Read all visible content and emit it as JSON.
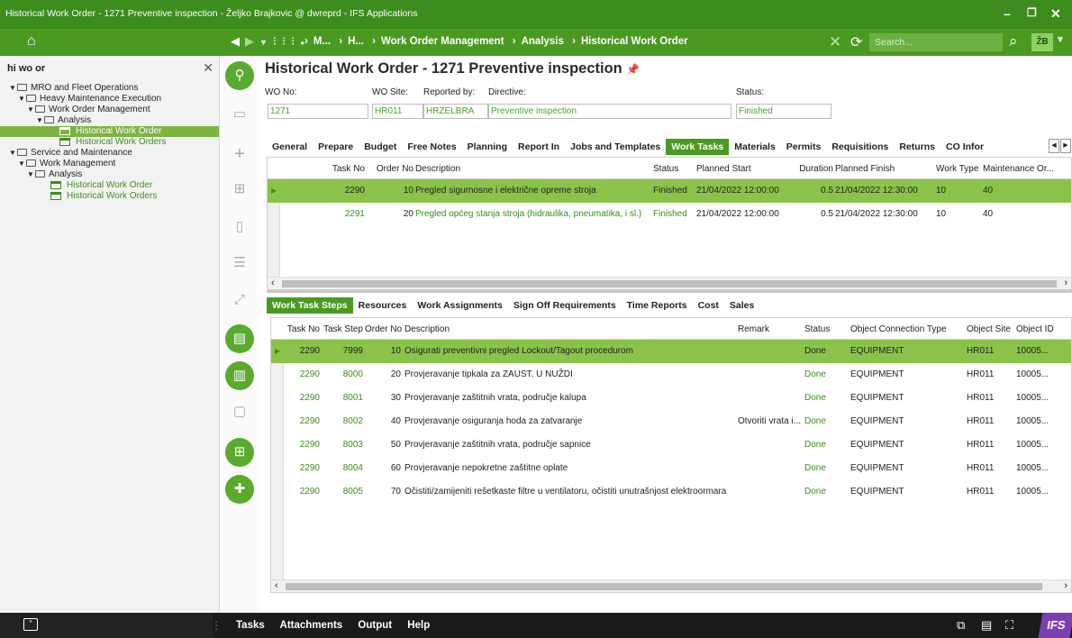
{
  "window": {
    "title": "Historical Work Order - 1271 Preventive inspection - Željko Brajkovic @ dwreprd - IFS Applications"
  },
  "nav": {
    "breadcrumbs": [
      "M...",
      "H...",
      "Work Order Management",
      "Analysis",
      "Historical Work Order"
    ],
    "search_placeholder": "Search...",
    "user_initials": "ŽB"
  },
  "navigator": {
    "search_text": "hi wo or",
    "tree": [
      {
        "label": "MRO and Fleet Operations",
        "level": 0,
        "type": "folder"
      },
      {
        "label": "Heavy Maintenance Execution",
        "level": 1,
        "type": "folder"
      },
      {
        "label": "Work Order Management",
        "level": 2,
        "type": "folder"
      },
      {
        "label": "Analysis",
        "level": 3,
        "type": "folder"
      },
      {
        "label": "Historical Work Order",
        "level": 4,
        "type": "page",
        "selected": true
      },
      {
        "label": "Historical Work Orders",
        "level": 4,
        "type": "page"
      },
      {
        "label": "Service and Maintenance",
        "level": 0,
        "type": "folder"
      },
      {
        "label": "Work Management",
        "level": 1,
        "type": "folder"
      },
      {
        "label": "Analysis",
        "level": 2,
        "type": "folder"
      },
      {
        "label": "Historical Work Order",
        "level": 3,
        "type": "page"
      },
      {
        "label": "Historical Work Orders",
        "level": 3,
        "type": "page"
      }
    ]
  },
  "page": {
    "title": "Historical Work Order - 1271 Preventive inspection",
    "fields": {
      "wo_no": {
        "label": "WO No:",
        "value": "1271"
      },
      "wo_site": {
        "label": "WO Site:",
        "value": "HR011"
      },
      "reported_by": {
        "label": "Reported by:",
        "value": "HRZELBRA"
      },
      "directive": {
        "label": "Directive:",
        "value": "Preventive inspection"
      },
      "status": {
        "label": "Status:",
        "value": "Finished"
      }
    },
    "main_tabs": [
      "General",
      "Prepare",
      "Budget",
      "Free Notes",
      "Planning",
      "Report In",
      "Jobs and Templates",
      "Work Tasks",
      "Materials",
      "Permits",
      "Requisitions",
      "Returns",
      "CO Infor"
    ],
    "active_main_tab": "Work Tasks",
    "tasks": {
      "headers": [
        "Task No",
        "Order No",
        "Description",
        "Status",
        "Planned Start",
        "Duration",
        "Planned Finish",
        "Work Type",
        "Maintenance Or..."
      ],
      "rows": [
        {
          "task_no": "2290",
          "order_no": "10",
          "description": "Pregled sigurnosne i električne opreme stroja",
          "status": "Finished",
          "planned_start": "21/04/2022 12:00:00",
          "duration": "0.5",
          "planned_finish": "21/04/2022 12:30:00",
          "work_type": "10",
          "maint_org": "40"
        },
        {
          "task_no": "2291",
          "order_no": "20",
          "description": "Pregled općeg stanja stroja (hidraulika, pneumatika, i sl.)",
          "status": "Finished",
          "planned_start": "21/04/2022 12:00:00",
          "duration": "0.5",
          "planned_finish": "21/04/2022 12:30:00",
          "work_type": "10",
          "maint_org": "40"
        }
      ]
    },
    "sub_tabs": [
      "Work Task Steps",
      "Resources",
      "Work Assignments",
      "Sign Off Requirements",
      "Time Reports",
      "Cost",
      "Sales"
    ],
    "active_sub_tab": "Work Task Steps",
    "steps": {
      "headers": [
        "Task No",
        "Task Step",
        "Order No",
        "Description",
        "Remark",
        "Status",
        "Object Connection Type",
        "Object Site",
        "Object ID"
      ],
      "rows": [
        {
          "task_no": "2290",
          "step": "7999",
          "order_no": "10",
          "description": "Osigurati preventivni pregled Lockout/Tagout procedurom",
          "remark": "",
          "status": "Done",
          "conn_type": "EQUIPMENT",
          "site": "HR011",
          "object_id": "10005..."
        },
        {
          "task_no": "2290",
          "step": "8000",
          "order_no": "20",
          "description": "Provjeravanje tipkala za ZAUST. U NUŽDI",
          "remark": "",
          "status": "Done",
          "conn_type": "EQUIPMENT",
          "site": "HR011",
          "object_id": "10005..."
        },
        {
          "task_no": "2290",
          "step": "8001",
          "order_no": "30",
          "description": "Provjeravanje zaštitnih vrata, područje kalupa",
          "remark": "",
          "status": "Done",
          "conn_type": "EQUIPMENT",
          "site": "HR011",
          "object_id": "10005..."
        },
        {
          "task_no": "2290",
          "step": "8002",
          "order_no": "40",
          "description": "Provjeravanje osiguranja hoda za zatvaranje",
          "remark": "Otvoriti vrata i...",
          "status": "Done",
          "conn_type": "EQUIPMENT",
          "site": "HR011",
          "object_id": "10005..."
        },
        {
          "task_no": "2290",
          "step": "8003",
          "order_no": "50",
          "description": "Provjeravanje zaštitnih vrata, područje sapnice",
          "remark": "",
          "status": "Done",
          "conn_type": "EQUIPMENT",
          "site": "HR011",
          "object_id": "10005..."
        },
        {
          "task_no": "2290",
          "step": "8004",
          "order_no": "60",
          "description": "Provjeravanje nepokretne zaštitne oplate",
          "remark": "",
          "status": "Done",
          "conn_type": "EQUIPMENT",
          "site": "HR011",
          "object_id": "10005..."
        },
        {
          "task_no": "2290",
          "step": "8005",
          "order_no": "70",
          "description": "Očistiti/zamijeniti rešetkaste filtre u ventilatoru, očistiti unutrašnjost elektroormara",
          "remark": "",
          "status": "Done",
          "conn_type": "EQUIPMENT",
          "site": "HR011",
          "object_id": "10005..."
        }
      ]
    }
  },
  "bottom": {
    "menu": [
      "Tasks",
      "Attachments",
      "Output",
      "Help"
    ],
    "logo": "IFS"
  },
  "colors": {
    "brand_green": "#3d8c1e",
    "selection_green": "#8bc34a",
    "nav_green": "#4a9a22"
  }
}
